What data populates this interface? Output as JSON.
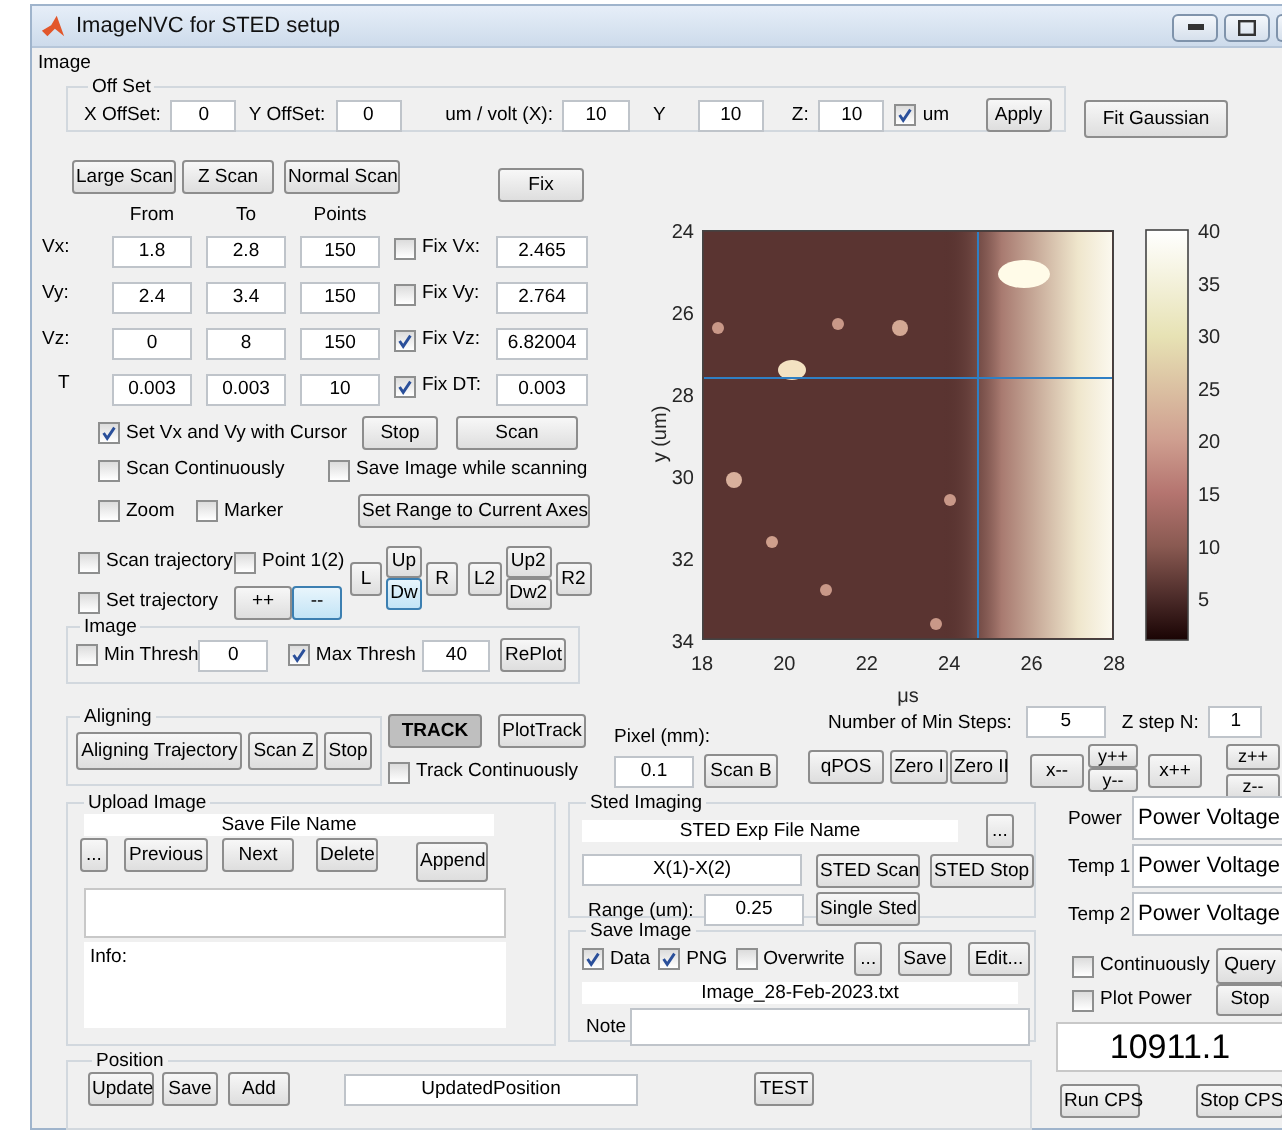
{
  "window": {
    "title": "ImageNVC for STED setup"
  },
  "image_panel": {
    "title": "Image"
  },
  "offset": {
    "title": "Off Set",
    "fields": [
      {
        "label": "X OffSet:",
        "value": "0"
      },
      {
        "label": "Y OffSet:",
        "value": "0"
      },
      {
        "label": "um / volt (X):",
        "value": "10"
      },
      {
        "label": "Y",
        "value": "10"
      },
      {
        "label": "Z:",
        "value": "10"
      }
    ],
    "um": {
      "label": "um",
      "checked": true
    },
    "apply": "Apply"
  },
  "fit_gaussian": "Fit Gaussian",
  "scan_buttons": [
    "Large Scan",
    "Z Scan",
    "Normal Scan"
  ],
  "fix_button": "Fix",
  "scan_table": {
    "columns": [
      "From",
      "To",
      "Points"
    ],
    "rows": [
      {
        "label": "Vx:",
        "from": "1.8",
        "to": "2.8",
        "points": "150",
        "fix": {
          "label": "Fix Vx:",
          "checked": false
        },
        "fix_value": "2.465"
      },
      {
        "label": "Vy:",
        "from": "2.4",
        "to": "3.4",
        "points": "150",
        "fix": {
          "label": "Fix Vy:",
          "checked": false
        },
        "fix_value": "2.764"
      },
      {
        "label": "Vz:",
        "from": "0",
        "to": "8",
        "points": "150",
        "fix": {
          "label": "Fix Vz:",
          "checked": true
        },
        "fix_value": "6.82004"
      },
      {
        "label": "T",
        "from": "0.003",
        "to": "0.003",
        "points": "10",
        "fix": {
          "label": "Fix DT:",
          "checked": true
        },
        "fix_value": "0.003"
      }
    ]
  },
  "cursor": {
    "label": "Set Vx and Vy  with Cursor",
    "checked": true
  },
  "stop": "Stop",
  "scan": "Scan",
  "scan_continuously": {
    "label": "Scan Continuously",
    "checked": false
  },
  "save_while_scanning": {
    "label": "Save Image while scanning",
    "checked": false
  },
  "zoom": {
    "label": "Zoom",
    "checked": false
  },
  "marker": {
    "label": "Marker",
    "checked": false
  },
  "set_range": "Set Range to Current Axes",
  "trajectory": {
    "scan": {
      "label": "Scan trajectory",
      "checked": false
    },
    "point": {
      "label": "Point 1(2)",
      "checked": false
    },
    "set": {
      "label": "Set trajectory",
      "checked": false
    },
    "plus": {
      "label": "++",
      "highlighted": false
    },
    "minus": {
      "label": "--",
      "highlighted": true
    }
  },
  "pads": [
    {
      "left": {
        "label": "L",
        "highlighted": false
      },
      "up": {
        "label": "Up",
        "highlighted": false
      },
      "down": {
        "label": "Dw",
        "highlighted": true
      },
      "right": {
        "label": "R",
        "highlighted": false
      }
    },
    {
      "left": {
        "label": "L2",
        "highlighted": false
      },
      "up": {
        "label": "Up2",
        "highlighted": false
      },
      "down": {
        "label": "Dw2",
        "highlighted": false
      },
      "right": {
        "label": "R2",
        "highlighted": false
      }
    }
  ],
  "threshold": {
    "title": "Image",
    "min": {
      "label": "Min Thresh",
      "checked": false,
      "value": "0"
    },
    "max": {
      "label": "Max Thresh",
      "checked": true,
      "value": "40"
    },
    "replot": "RePlot"
  },
  "plot": {
    "y_label": "y (um)",
    "x_label": "μs",
    "x_ticks": [
      "18",
      "20",
      "22",
      "24",
      "26",
      "28"
    ],
    "y_ticks": [
      "24",
      "26",
      "28",
      "30",
      "32",
      "34"
    ],
    "colorbar_ticks": [
      "40",
      "35",
      "30",
      "25",
      "20",
      "15",
      "10",
      "5"
    ]
  },
  "aligning": {
    "title": "Aligning",
    "buttons": [
      "Aligning Trajectory",
      "Scan Z",
      "Stop"
    ]
  },
  "track": {
    "button": {
      "label": "TRACK",
      "pressed": true
    },
    "plot_track": "PlotTrack",
    "continuously": {
      "label": "Track Continuously",
      "checked": false
    }
  },
  "pixel": {
    "label": "Pixel (mm):",
    "value": "0.1",
    "scan_b": "Scan B"
  },
  "min_steps": {
    "label": "Number of Min Steps:",
    "value": "5"
  },
  "z_step": {
    "label": "Z step N:",
    "value": "1"
  },
  "position_buttons": [
    "qPOS",
    "Zero I",
    "Zero II"
  ],
  "jog": {
    "x_minus": "x--",
    "y_plus": "y++",
    "y_minus": "y--",
    "x_plus": "x++",
    "z_plus": "z++",
    "z_minus": "z--"
  },
  "upload": {
    "title": "Upload Image",
    "file_name": "Save File Name",
    "browse": "...",
    "buttons": [
      "Previous",
      "Next",
      "Delete"
    ],
    "append": "Append",
    "info": "Info:"
  },
  "sted": {
    "title": "Sted Imaging",
    "file_name": "STED Exp File Name",
    "browse": "...",
    "range_field": "X(1)-X(2)",
    "range_label": "Range (um):",
    "range_value": "0.25",
    "scan": "STED Scan",
    "stop": "STED Stop",
    "single": "Single Sted"
  },
  "save_image": {
    "title": "Save Image",
    "data": {
      "label": "Data",
      "checked": true
    },
    "png": {
      "label": "PNG",
      "checked": true
    },
    "overwrite": {
      "label": "Overwrite",
      "checked": false
    },
    "browse": "...",
    "save": "Save",
    "edit": "Edit...",
    "file_name": "Image_28-Feb-2023.txt",
    "note_label": "Note"
  },
  "readings": [
    {
      "label": "Power",
      "value": "Power Voltage"
    },
    {
      "label": "Temp 1",
      "value": "Power Voltage"
    },
    {
      "label": "Temp 2",
      "value": "Power Voltage"
    }
  ],
  "continuously": {
    "label": "Continuously",
    "checked": false
  },
  "query": "Query",
  "plot_power": {
    "label": "Plot Power",
    "checked": false
  },
  "power_stop": "Stop",
  "counts": "10911.1",
  "run_cps": "Run CPS",
  "stop_cps": "Stop CPS",
  "position": {
    "title": "Position",
    "buttons": [
      "Update",
      "Save",
      "Add"
    ],
    "value": "UpdatedPosition",
    "test": "TEST"
  }
}
